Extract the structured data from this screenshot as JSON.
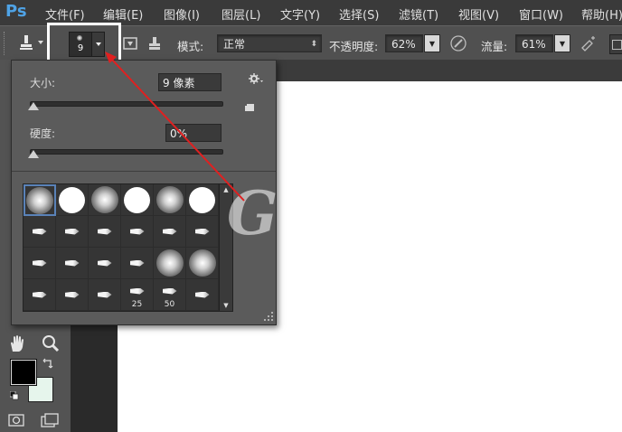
{
  "app": {
    "logo": "Ps"
  },
  "menu": [
    {
      "label": "文件(F)"
    },
    {
      "label": "编辑(E)"
    },
    {
      "label": "图像(I)"
    },
    {
      "label": "图层(L)"
    },
    {
      "label": "文字(Y)"
    },
    {
      "label": "选择(S)"
    },
    {
      "label": "滤镜(T)"
    },
    {
      "label": "视图(V)"
    },
    {
      "label": "窗口(W)"
    },
    {
      "label": "帮助(H)"
    }
  ],
  "options": {
    "brush_size_preview": "9",
    "mode_label": "模式:",
    "mode_value": "正常",
    "opacity_label": "不透明度:",
    "opacity_value": "62%",
    "flow_label": "流量:",
    "flow_value": "61%"
  },
  "brush_panel": {
    "size_label": "大小:",
    "size_value": "9 像素",
    "size_fraction": 0.02,
    "hardness_label": "硬度:",
    "hardness_value": "0%",
    "hardness_fraction": 0.0,
    "presets": [
      {
        "kind": "soft-round",
        "selected": true
      },
      {
        "kind": "hard-round"
      },
      {
        "kind": "soft-round"
      },
      {
        "kind": "hard-round"
      },
      {
        "kind": "soft-round"
      },
      {
        "kind": "hard-round"
      },
      {
        "kind": "brush-tip"
      },
      {
        "kind": "brush-tip"
      },
      {
        "kind": "brush-tip"
      },
      {
        "kind": "brush-tip"
      },
      {
        "kind": "brush-tip"
      },
      {
        "kind": "brush-tip"
      },
      {
        "kind": "brush-tip"
      },
      {
        "kind": "brush-tip"
      },
      {
        "kind": "brush-tip"
      },
      {
        "kind": "brush-tip"
      },
      {
        "kind": "soft-round"
      },
      {
        "kind": "soft-round"
      },
      {
        "kind": "brush-tip"
      },
      {
        "kind": "brush-tip"
      },
      {
        "kind": "brush-tip"
      },
      {
        "kind": "brush-tip",
        "label": "25"
      },
      {
        "kind": "brush-tip",
        "label": "50"
      },
      {
        "kind": "brush-tip"
      }
    ]
  },
  "colors": {
    "foreground": "#000000",
    "background": "#e6f5ec",
    "annotation": "#e02020",
    "highlight_box": "#ffffff",
    "accent": "#4fa3e6"
  }
}
